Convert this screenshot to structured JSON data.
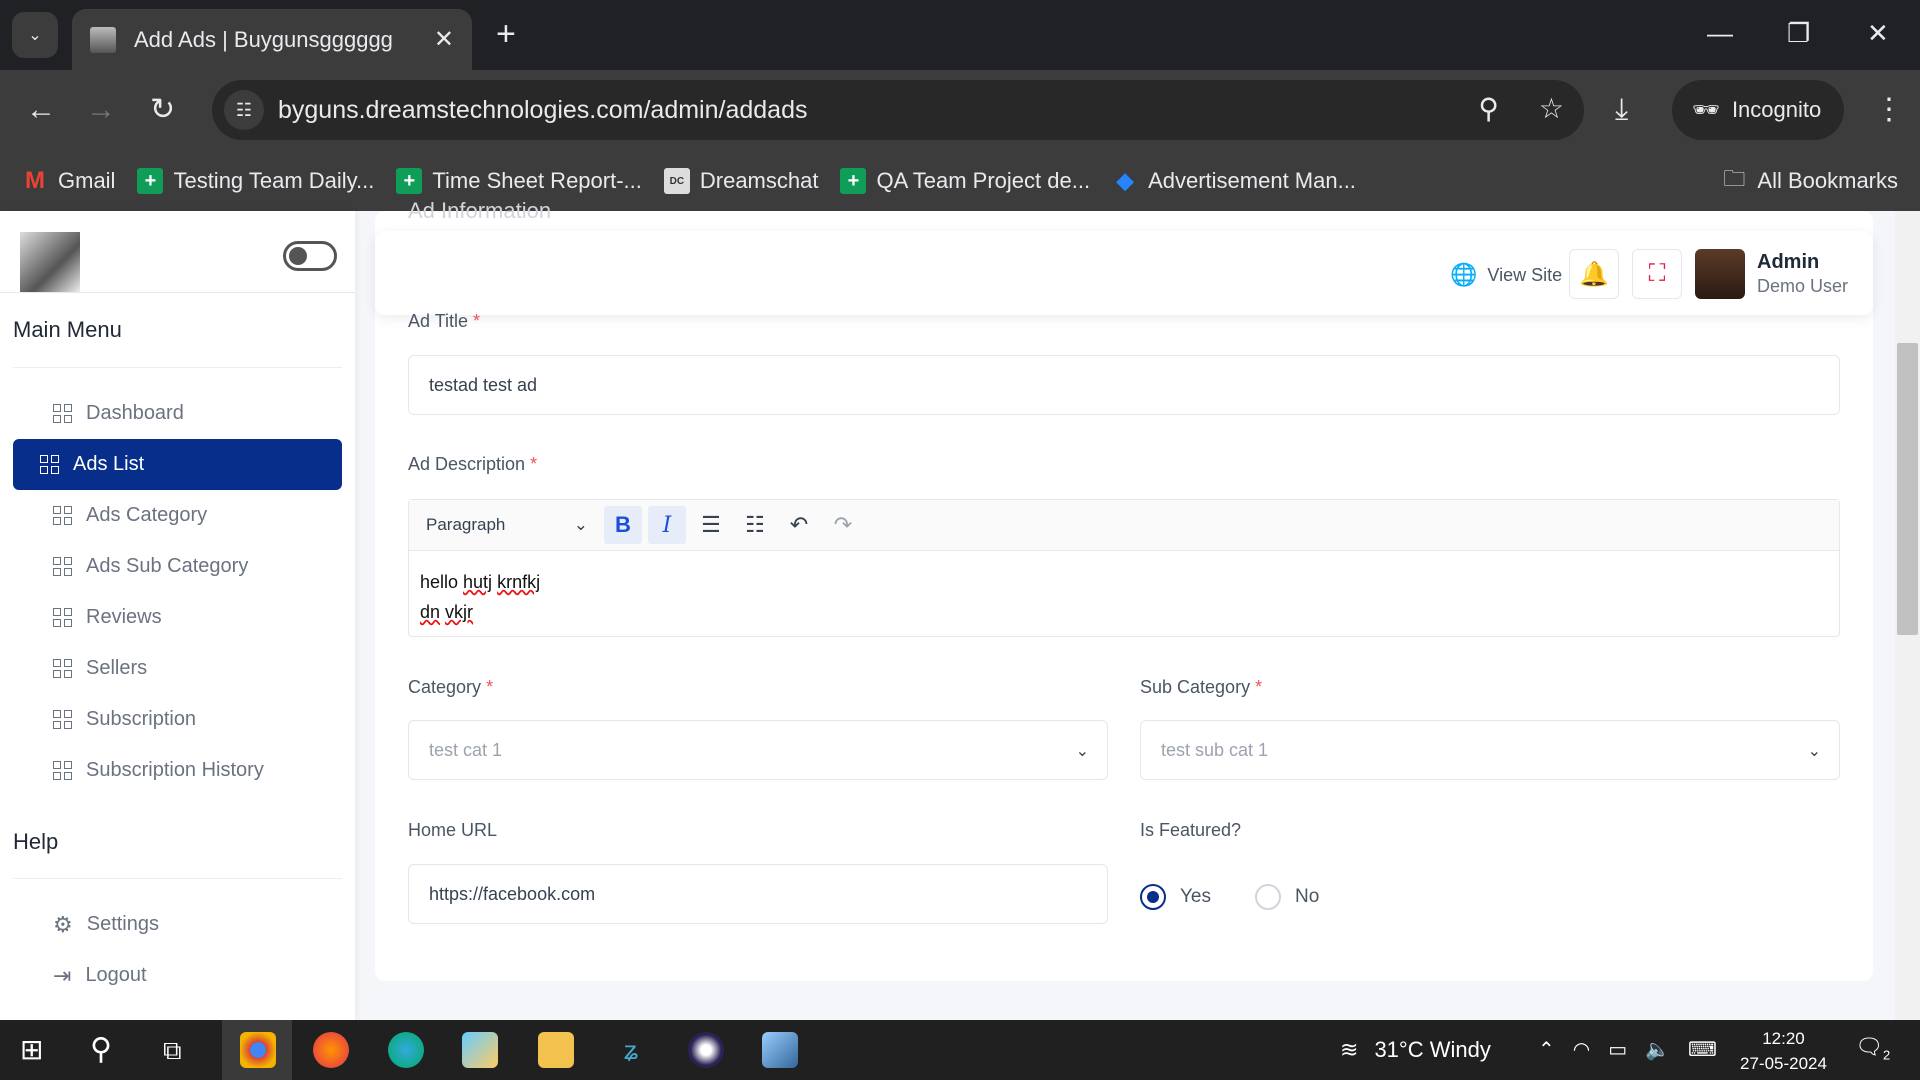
{
  "browser": {
    "tab_title": "Add Ads | Buygunsgggggg",
    "url": "byguns.dreamstechnologies.com/admin/addads",
    "incognito_label": "Incognito",
    "bookmarks": [
      {
        "label": "Gmail",
        "icon": "gmail-icon"
      },
      {
        "label": "Testing Team Daily...",
        "icon": "sheets-icon"
      },
      {
        "label": "Time Sheet Report-...",
        "icon": "sheets-icon"
      },
      {
        "label": "Dreamschat",
        "icon": "dreamschat-icon"
      },
      {
        "label": "QA Team Project de...",
        "icon": "sheets-icon"
      },
      {
        "label": "Advertisement Man...",
        "icon": "jira-icon"
      }
    ],
    "all_bookmarks": "All Bookmarks"
  },
  "sidebar": {
    "main_menu": "Main Menu",
    "items": [
      {
        "label": "Dashboard"
      },
      {
        "label": "Ads List"
      },
      {
        "label": "Ads Category"
      },
      {
        "label": "Ads Sub Category"
      },
      {
        "label": "Reviews"
      },
      {
        "label": "Sellers"
      },
      {
        "label": "Subscription"
      },
      {
        "label": "Subscription History"
      }
    ],
    "help": "Help",
    "help_items": [
      {
        "label": "Settings"
      },
      {
        "label": "Logout"
      }
    ]
  },
  "header": {
    "view_site": "View Site",
    "admin_name": "Admin",
    "admin_role": "Demo User"
  },
  "form": {
    "section_title": "Ad Information",
    "ad_title_label": "Ad Title",
    "ad_title_value": "testad test ad",
    "ad_desc_label": "Ad Description",
    "paragraph_label": "Paragraph",
    "desc_line1_a": "hello ",
    "desc_line1_b": "hutj",
    "desc_line1_c": " ",
    "desc_line1_d": "krnfkj",
    "desc_line2_a": "dn",
    "desc_line2_b": " ",
    "desc_line2_c": "vkjr",
    "category_label": "Category",
    "category_value": "test cat 1",
    "subcategory_label": "Sub Category",
    "subcategory_value": "test sub cat 1",
    "home_url_label": "Home URL",
    "home_url_value": "https://facebook.com",
    "featured_label": "Is Featured?",
    "featured_yes": "Yes",
    "featured_no": "No",
    "required_mark": "*"
  },
  "taskbar": {
    "weather": "31°C  Windy",
    "time": "12:20",
    "date": "27-05-2024",
    "notifications": "2"
  }
}
